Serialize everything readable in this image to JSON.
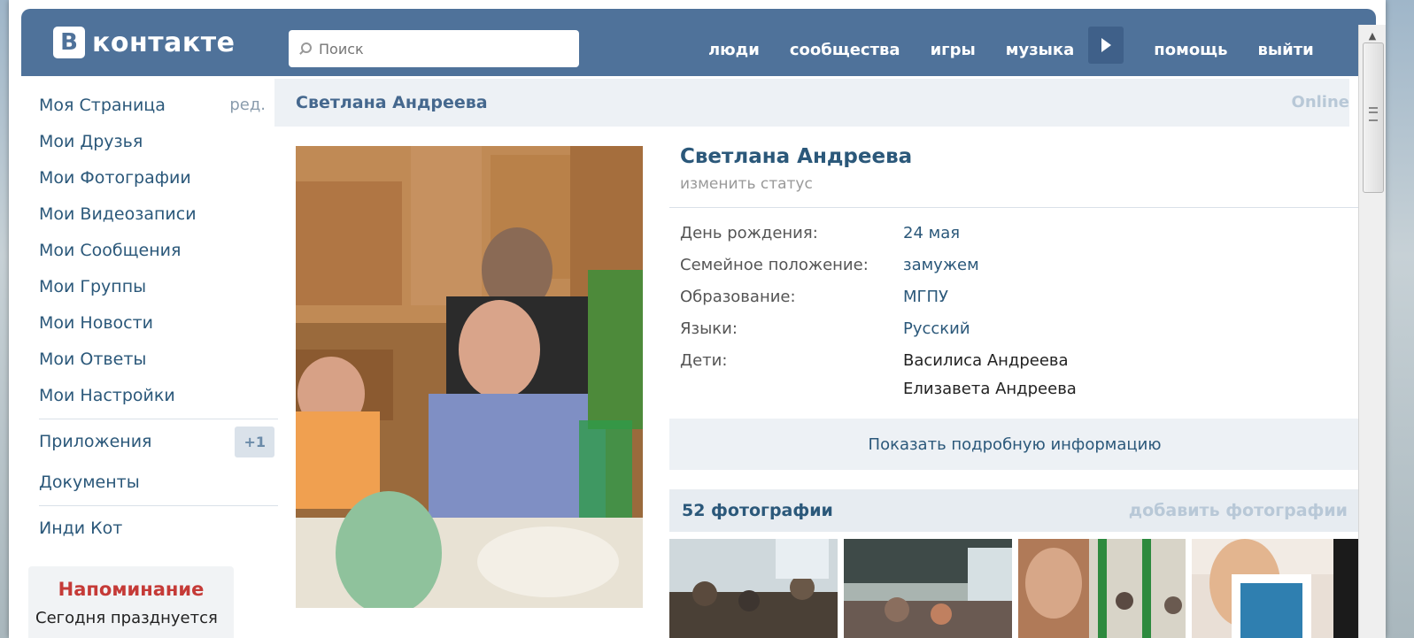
{
  "header": {
    "logo_letter": "В",
    "logo_text": "контакте",
    "search_placeholder": "Поиск",
    "nav": [
      "люди",
      "сообщества",
      "игры",
      "музыка",
      "помощь",
      "выйти"
    ]
  },
  "sidebar": {
    "items": [
      {
        "label": "Моя Страница",
        "extra": "ред."
      },
      {
        "label": "Мои Друзья"
      },
      {
        "label": "Мои Фотографии"
      },
      {
        "label": "Мои Видеозаписи"
      },
      {
        "label": "Мои Сообщения"
      },
      {
        "label": "Мои Группы"
      },
      {
        "label": "Мои Новости"
      },
      {
        "label": "Мои Ответы"
      },
      {
        "label": "Мои Настройки"
      }
    ],
    "apps_label": "Приложения",
    "apps_badge": "+1",
    "docs_label": "Документы",
    "extra_app": "Инди Кот",
    "reminder_title": "Напоминание",
    "reminder_text": "Сегодня празднуется"
  },
  "main": {
    "title": "Светлана Андреева",
    "online": "Online"
  },
  "profile": {
    "name": "Светлана Андреева",
    "status": "изменить статус",
    "info": [
      {
        "label": "День рождения:",
        "value": "24 мая"
      },
      {
        "label": "Семейное положение:",
        "value": "замужем"
      },
      {
        "label": "Образование:",
        "value": "МГПУ"
      },
      {
        "label": "Языки:",
        "value": "Русский"
      }
    ],
    "children_label": "Дети:",
    "children": [
      "Василиса Андреева",
      "Елизавета Андреева"
    ],
    "show_more": "Показать подробную информацию",
    "photos_count": "52 фотографии",
    "photos_add": "добавить фотографии"
  },
  "colors": {
    "brand": "#4f729a",
    "link": "#2b587a",
    "reminder": "#c53a37"
  }
}
